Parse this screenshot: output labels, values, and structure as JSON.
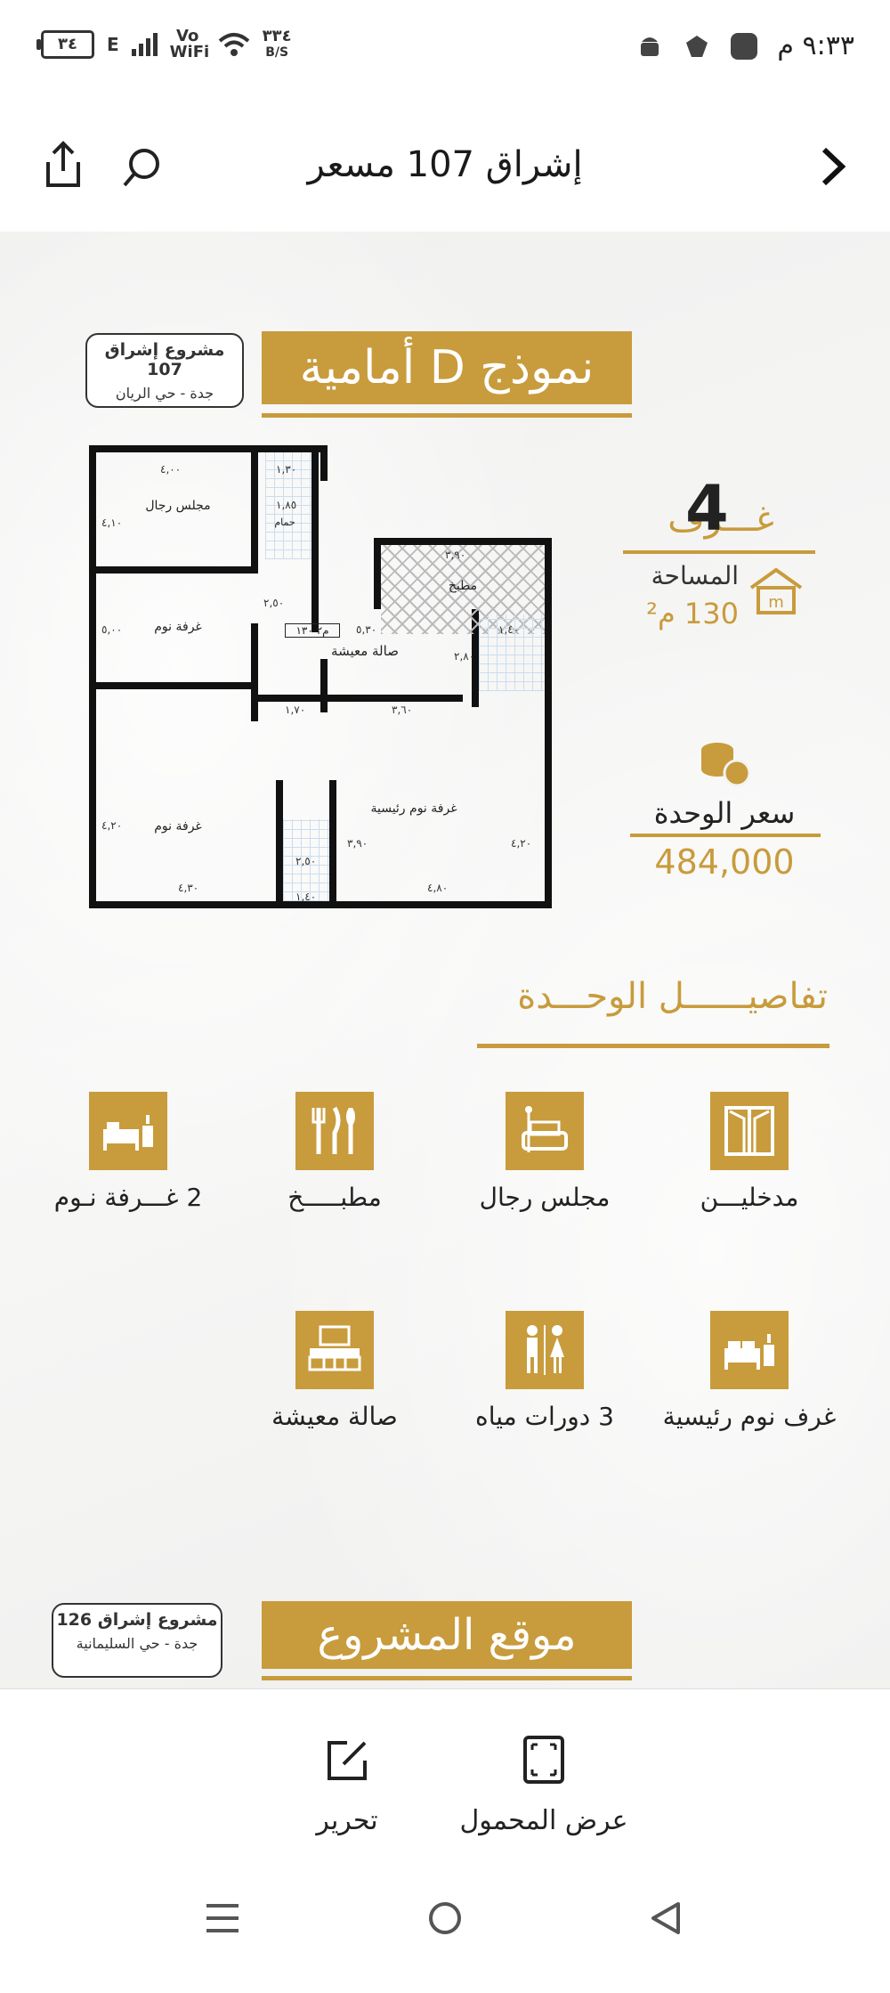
{
  "status_bar": {
    "time": "٩:٣٣ م",
    "battery": "٣٤",
    "network": "E",
    "wifi_label": "Vo WiFi",
    "speed_value": "٣٣٤",
    "speed_unit": "B/S"
  },
  "header": {
    "title": "إشراق 107 مسعر",
    "back_icon": "chevron-right-icon",
    "search_icon": "search-icon",
    "share_icon": "share-icon"
  },
  "content": {
    "model_title": "نموذج D أمامية",
    "project_tag": {
      "title": "مشروع إشراق 107",
      "location": "جدة - حي الريان"
    },
    "rooms_label": "غـــرف",
    "rooms_count": "4",
    "area_label": "المساحة",
    "area_value": "130 م²",
    "price_label": "سعر الوحدة",
    "price_value": "484,000",
    "details_title": "تفاصيــــــل الوحـــدة",
    "features": [
      {
        "label": "مدخليـــن",
        "icon": "doors-icon"
      },
      {
        "label": "مجلس رجال",
        "icon": "majlis-icon"
      },
      {
        "label": "مطبـــــخ",
        "icon": "kitchen-icon"
      },
      {
        "label": "2 غـــرفة نـوم",
        "icon": "bed-icon"
      },
      {
        "label": "غرف نوم رئيسية",
        "icon": "master-bed-icon"
      },
      {
        "label": "3 دورات مياه",
        "icon": "restroom-icon"
      },
      {
        "label": "صالة معيشة",
        "icon": "living-room-icon"
      }
    ],
    "location_title": "موقع المشروع",
    "project_tag2": {
      "title": "مشروع إشراق 126",
      "location": "جدة - حي السليمانية"
    },
    "plan": {
      "rooms": {
        "majlis": "مجلس رجال",
        "bedroom1": "غرفة نوم",
        "bedroom2": "غرفة نوم",
        "living": "صالة معيشة",
        "kitchen": "مطبخ",
        "master": "غرفة نوم رئيسية",
        "bath": "حمام",
        "area_tag": "م٢ ١٣٠"
      },
      "dims": [
        "٤,٠٠",
        "٤,١٠",
        "١,٣٠",
        "١,٨٥",
        "٢,٥٠",
        "٣,٩٠",
        "٥,٣٠",
        "٢,٨٠",
        "١,٤٠",
        "١,٧٠",
        "٣,٦٠",
        "٤,٣٠",
        "٤,٨٠",
        "٣,٩٠",
        "٤,٢٠",
        "٢,٥٠",
        "١,٤٠",
        "٥,٠٠",
        "٤,٢٠"
      ]
    }
  },
  "toolbar": {
    "edit_label": "تحرير",
    "edit_icon": "edit-icon",
    "portable_label": "عرض المحمول",
    "portable_icon": "expand-icon"
  },
  "navbar": {
    "menu_icon": "recent-apps-icon",
    "home_icon": "home-icon",
    "back_icon": "back-triangle-icon"
  },
  "colors": {
    "gold": "#c89b3c",
    "bg": "#f3f3f2"
  }
}
